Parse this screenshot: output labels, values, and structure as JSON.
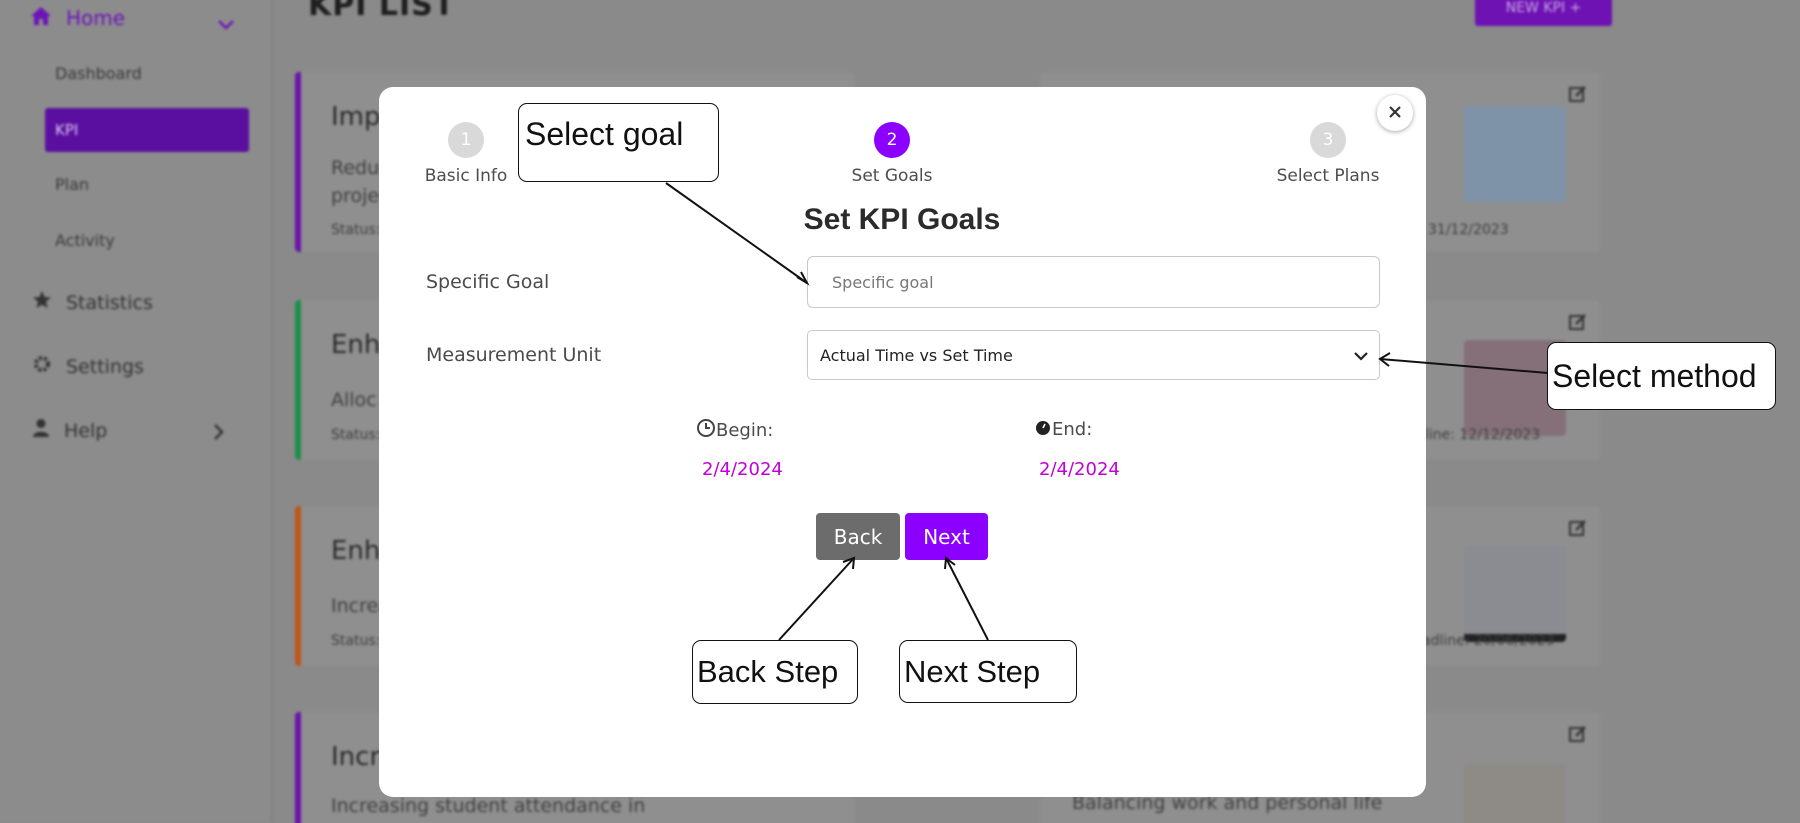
{
  "sidebar": {
    "home_label": "Home",
    "sub_items": [
      "Dashboard",
      "KPI",
      "Plan",
      "Activity"
    ],
    "statistics_label": "Statistics",
    "settings_label": "Settings",
    "help_label": "Help"
  },
  "page": {
    "title": "KPI LIST",
    "new_kpi_label": "NEW KPI  +"
  },
  "cards_left": [
    {
      "title": "Imp",
      "desc": "Reduc\nprojec",
      "status": "Status:",
      "accent": "#6a16a8"
    },
    {
      "title": "Enh",
      "desc": "Alloc",
      "status": "Status:",
      "accent": "#1f8f4a"
    },
    {
      "title": "Enh",
      "desc": "Increa",
      "status": "Status:",
      "accent": "#c0561b"
    },
    {
      "title": "Incr",
      "desc": "Increasing student attendance in",
      "status": "",
      "accent": "#6a16a8"
    }
  ],
  "cards_right": [
    {
      "deadline": "31/12/2023",
      "desc": ""
    },
    {
      "deadline": "line: 12/12/2023",
      "desc": ""
    },
    {
      "deadline": "adline: 20/06/2023",
      "desc": ""
    },
    {
      "deadline": "",
      "desc": "Balancing work and personal life"
    }
  ],
  "modal": {
    "steps": [
      {
        "num": "1",
        "label": "Basic Info"
      },
      {
        "num": "2",
        "label": "Set Goals"
      },
      {
        "num": "3",
        "label": "Select Plans"
      }
    ],
    "title": "Set KPI Goals",
    "specific_goal_label": "Specific Goal",
    "specific_goal_placeholder": "Specific goal",
    "measurement_label": "Measurement Unit",
    "measurement_value": "Actual Time vs Set Time",
    "begin_label": "Begin:",
    "begin_value": "2/4/2024",
    "end_label": "End:",
    "end_value": "2/4/2024",
    "back_label": "Back",
    "next_label": "Next"
  },
  "callouts": {
    "select_goal": "Select goal",
    "select_method": "Select method",
    "back_step": "Back Step",
    "next_step": "Next Step"
  },
  "colors": {
    "accent": "#8b00ff",
    "date": "#c000d8",
    "back_button": "#6c6c6c"
  }
}
